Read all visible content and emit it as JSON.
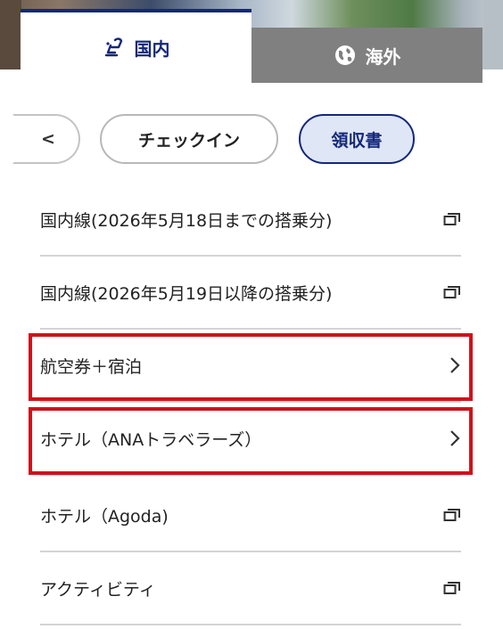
{
  "tabs": {
    "domestic": {
      "label": "国内",
      "icon": "seat-icon",
      "active": true
    },
    "international": {
      "label": "海外",
      "icon": "globe-icon",
      "active": false
    }
  },
  "pills": {
    "prev_label": "<",
    "checkin_label": "チェックイン",
    "receipt_label": "領収書",
    "selected": "領収書"
  },
  "list": [
    {
      "label": "国内線(2026年5月18日までの搭乗分)",
      "icon": "external-window-icon"
    },
    {
      "label": "国内線(2026年5月19日以降の搭乗分)",
      "icon": "external-window-icon"
    },
    {
      "label": "航空券＋宿泊",
      "icon": "chevron-right-icon"
    },
    {
      "label": "ホテル（ANAトラベラーズ）",
      "icon": "chevron-right-icon"
    },
    {
      "label": "ホテル（Agoda)",
      "icon": "external-window-icon"
    },
    {
      "label": "アクティビティ",
      "icon": "external-window-icon"
    }
  ],
  "colors": {
    "brand_navy": "#14287a",
    "highlight_red": "#d0121b",
    "inactive_tab": "#808080",
    "selected_pill_bg": "#dfe6f6"
  }
}
